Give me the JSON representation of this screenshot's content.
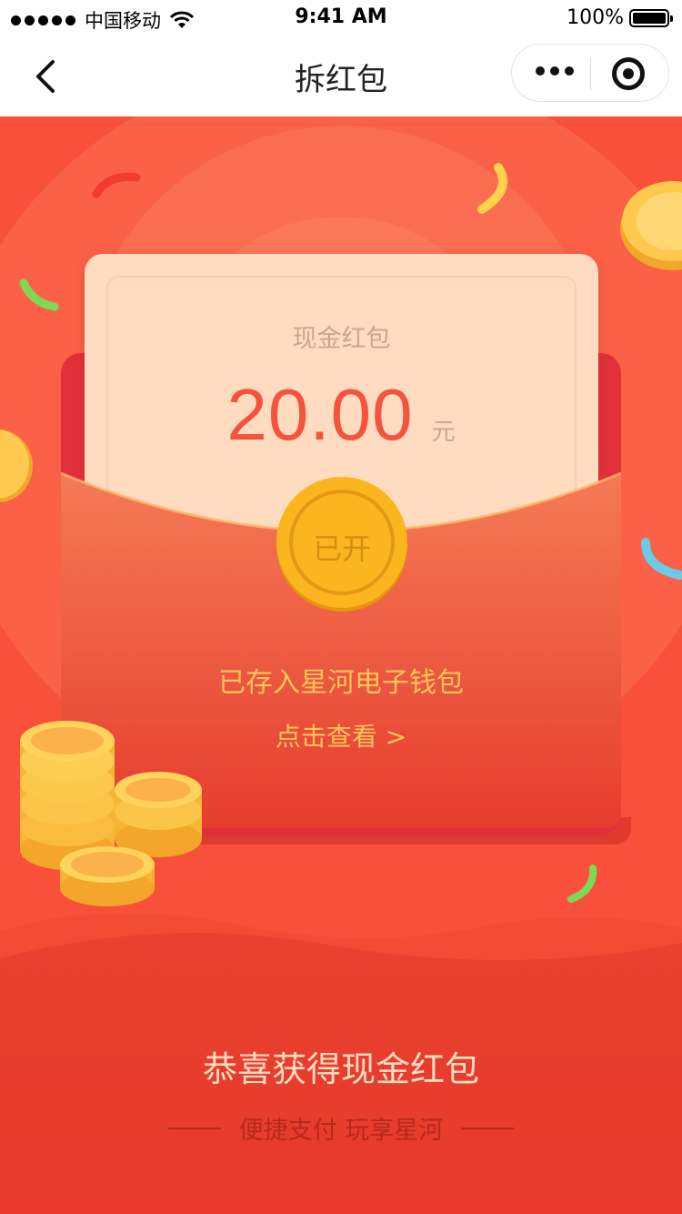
{
  "status_bar": {
    "carrier": "中国移动",
    "time": "9:41 AM",
    "battery": "100%",
    "icons": [
      "signal-icon",
      "wifi-icon",
      "battery-icon"
    ]
  },
  "nav": {
    "title": "拆红包",
    "back_icon": "chevron-left-icon",
    "more_icon": "more-dots-icon",
    "close_icon": "target-icon"
  },
  "envelope": {
    "card_label": "现金红包",
    "amount": "20.00",
    "currency": "元",
    "open_button": "已开",
    "saved_message": "已存入星河电子钱包",
    "view_link": "点击查看 >"
  },
  "footer": {
    "congrats": "恭喜获得现金红包",
    "slogan": "便捷支付 玩享星河"
  },
  "colors": {
    "background_red": "#f8503a",
    "card_cream": "#ffdcc0",
    "amount_red": "#f4543e",
    "gold": "#ffc45a"
  }
}
